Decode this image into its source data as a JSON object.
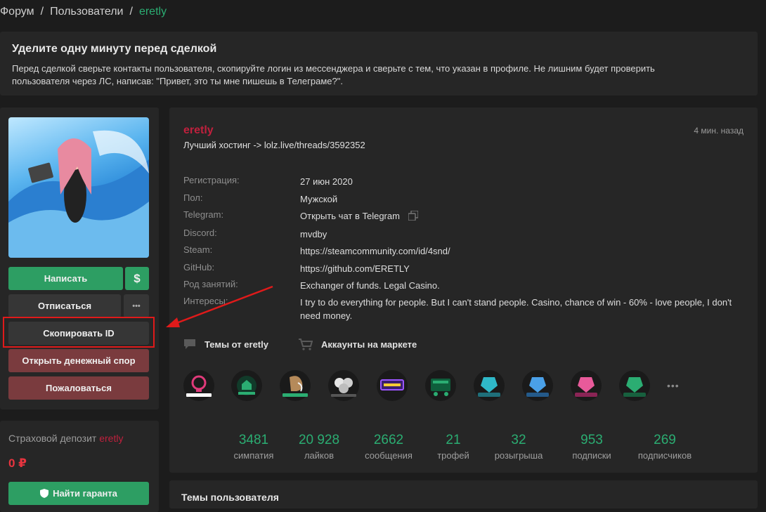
{
  "breadcrumb": {
    "items": [
      "Форум",
      "Пользователи"
    ],
    "current": "eretly"
  },
  "notice": {
    "title": "Уделите одну минуту перед сделкой",
    "body": "Перед сделкой сверьте контакты пользователя, скопируйте логин из мессенджера и сверьте с тем, что указан в профиле. Не лишним будет проверить пользователя через ЛС, написав: \"Привет, это ты мне пишешь в Телеграме?\"."
  },
  "sidebar": {
    "write_label": "Написать",
    "money_icon": "$",
    "unsubscribe_label": "Отписаться",
    "more_label": "•••",
    "copy_id_label": "Скопировать ID",
    "dispute_label": "Открыть денежный спор",
    "report_label": "Пожаловаться",
    "deposit_label": "Страховой депозит",
    "deposit_user": "eretly",
    "deposit_value": "0 ₽",
    "guarantor_label": "Найти гаранта"
  },
  "profile": {
    "username": "eretly",
    "status": "Лучший хостинг -> lolz.live/threads/3592352",
    "last_seen": "4 мин. назад",
    "fields": [
      {
        "key": "Регистрация:",
        "value": "27 июн 2020"
      },
      {
        "key": "Пол:",
        "value": "Мужской"
      },
      {
        "key": "Telegram:",
        "value": "Открыть чат в Telegram"
      },
      {
        "key": "Discord:",
        "value": "mvdby"
      },
      {
        "key": "Steam:",
        "value": "https://steamcommunity.com/id/4snd/"
      },
      {
        "key": "GitHub:",
        "value": "https://github.com/ERETLY"
      },
      {
        "key": "Род занятий:",
        "value": "Exchanger of funds. Legal Casino."
      },
      {
        "key": "Интересы:",
        "value": "I try to do everything for people. But I can't stand people. Casino, chance of win - 60% - love people, I don't need money."
      }
    ],
    "tabs": {
      "threads": "Темы от eretly",
      "market": "Аккаунты на маркете"
    },
    "trophy_more": "•••",
    "stats": [
      {
        "value": "3481",
        "label": "симпатия"
      },
      {
        "value": "20 928",
        "label": "лайков"
      },
      {
        "value": "2662",
        "label": "сообщения"
      },
      {
        "value": "21",
        "label": "трофей"
      },
      {
        "value": "32",
        "label": "розыгрыша"
      },
      {
        "value": "953",
        "label": "подписки"
      },
      {
        "value": "269",
        "label": "подписчиков"
      }
    ]
  },
  "topics": {
    "title": "Темы пользователя"
  }
}
